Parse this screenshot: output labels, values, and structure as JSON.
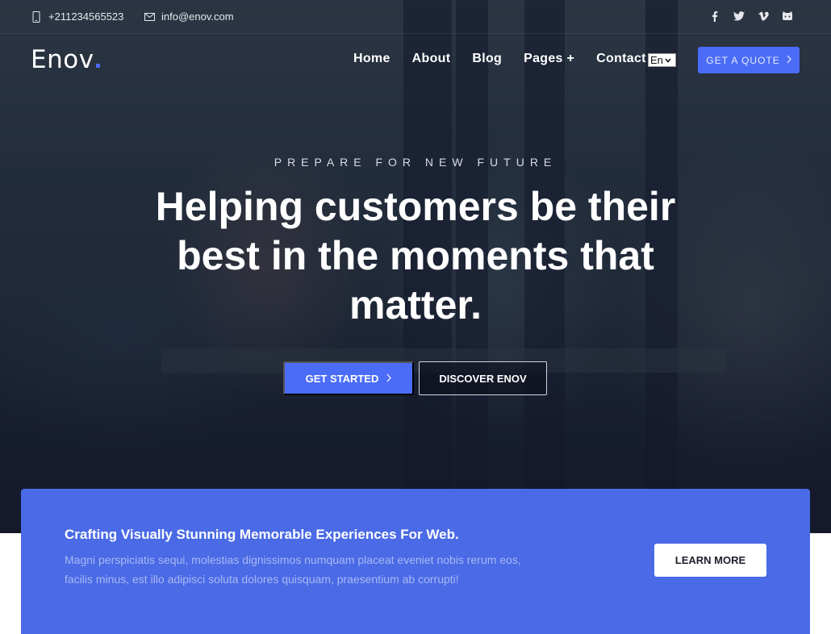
{
  "topbar": {
    "phone": "+211234565523",
    "email": "info@enov.com",
    "socials": [
      {
        "name": "facebook-icon",
        "glyph": "f"
      },
      {
        "name": "twitter-icon",
        "glyph": "t"
      },
      {
        "name": "vimeo-icon",
        "glyph": "v"
      },
      {
        "name": "github-icon",
        "glyph": "g"
      }
    ]
  },
  "header": {
    "logo": "Enov",
    "nav": [
      "Home",
      "About",
      "Blog",
      "Pages +",
      "Contact"
    ],
    "language": "En",
    "quote_button": "GET A QUOTE"
  },
  "hero": {
    "eyebrow": "PREPARE FOR NEW FUTURE",
    "headline": "Helping customers be their best in the moments that matter.",
    "primary_cta": "GET STARTED",
    "secondary_cta": "DISCOVER ENOV"
  },
  "band": {
    "title": "Crafting Visually Stunning Memorable Experiences For Web.",
    "text": "Magni perspiciatis sequi, molestias dignissimos numquam placeat eveniet nobis rerum eos, facilis minus, est illo adipisci soluta dolores quisquam, praesentium ab corrupti!",
    "button": "LEARN MORE"
  },
  "colors": {
    "accent": "#4a6cf7",
    "band": "#4a6ae6"
  }
}
